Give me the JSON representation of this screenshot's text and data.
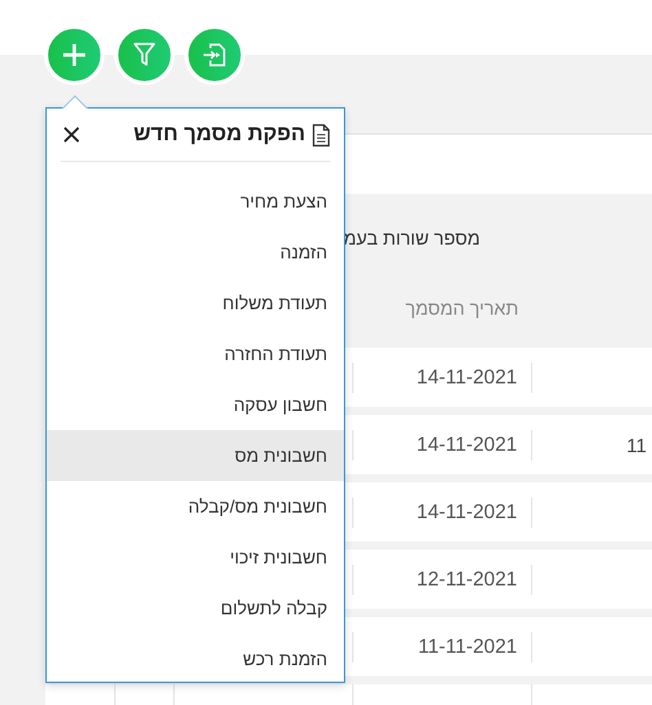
{
  "toolbar": {
    "buttons": [
      {
        "kind": "add"
      },
      {
        "kind": "filter"
      },
      {
        "kind": "export"
      }
    ]
  },
  "table": {
    "rows_per_page_label": "מספר שורות בעמ",
    "date_column_header": "תאריך המסמך",
    "rows": [
      {
        "date": "14-11-2021"
      },
      {
        "column_1": "11",
        "date": "14-11-2021"
      },
      {
        "date": "14-11-2021"
      },
      {
        "date": "12-11-2021"
      },
      {
        "date": "11-11-2021"
      }
    ]
  },
  "popup": {
    "title": "הפקת מסמך חדש",
    "items": [
      {
        "label": "הצעת מחיר",
        "selected": false
      },
      {
        "label": "הזמנה",
        "selected": false
      },
      {
        "label": "תעודת משלוח",
        "selected": false
      },
      {
        "label": "תעודת החזרה",
        "selected": false
      },
      {
        "label": "חשבון עסקה",
        "selected": false
      },
      {
        "label": "חשבונית מס",
        "selected": true
      },
      {
        "label": "חשבונית מס/קבלה",
        "selected": false
      },
      {
        "label": "חשבונית זיכוי",
        "selected": false
      },
      {
        "label": "קבלה לתשלום",
        "selected": false
      },
      {
        "label": "הזמנת רכש",
        "selected": false
      }
    ]
  }
}
